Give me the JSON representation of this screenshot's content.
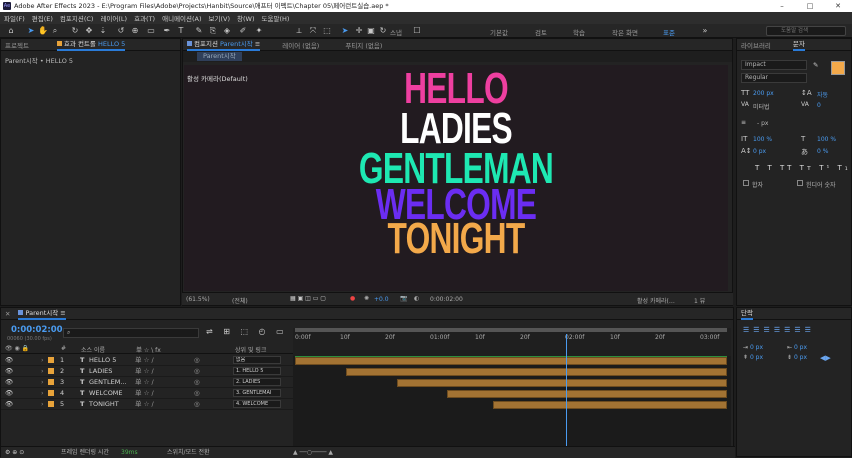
{
  "window": {
    "title": "Adobe After Effects 2023 - E:\\Program Files\\Adobe\\Projects\\Hanbit\\Source\\애프터 이펙트\\Chapter 05\\페어런트실습.aep *",
    "minimize": "–",
    "maximize": "□",
    "close": "✕"
  },
  "menu": [
    "파일(F)",
    "편집(E)",
    "컴포지션(C)",
    "레이어(L)",
    "효과(T)",
    "애니메이션(A)",
    "보기(V)",
    "창(W)",
    "도움말(H)"
  ],
  "toolbar": {
    "snap_label": "스냅",
    "workspaces": [
      "기본값",
      "검토",
      "학습",
      "작은 화면",
      "표준"
    ],
    "search_placeholder": "도움말 검색"
  },
  "project_panel": {
    "tab_project": "프로젝트",
    "tab_effects": "효과 컨트롤",
    "tab_effects_target": "HELLO 5",
    "breadcrumb": "Parent시작 • HELLO 5"
  },
  "comp_panel": {
    "tab_comp": "컴포지션",
    "comp_name": "Parent시작",
    "tab_layer": "레이어 (없음)",
    "tab_footage": "푸티지 (없음)",
    "flow_tab": "Parent시작",
    "camera_label": "활성 카메라(Default)",
    "words": [
      {
        "text": "HELLO",
        "color": "#ee3fa0"
      },
      {
        "text": "LADIES",
        "color": "#ffffff"
      },
      {
        "text": "GENTLEMAN",
        "color": "#1ee8b2"
      },
      {
        "text": "WELCOME",
        "color": "#6b2df2"
      },
      {
        "text": "TONIGHT",
        "color": "#f3a94a"
      }
    ],
    "footer": {
      "zoom": "(61.5%)",
      "quality": "(전체)",
      "exposure": "+0.0",
      "time": "0:00:02:00",
      "view": "활성 카메라(…",
      "views": "1 뷰"
    }
  },
  "right_panel": {
    "tab_library": "라이브러리",
    "tab_character": "문자",
    "font": "Impact",
    "style": "Regular",
    "size": "200 px",
    "leading": "자동",
    "kerning": "미터법",
    "tracking": "0",
    "stroke": "- px",
    "vscale": "100 %",
    "hscale": "100 %",
    "baseline": "0 px",
    "tsume": "0 %",
    "fill_color": "#f3a94a",
    "faux_bold": "합자",
    "hindi_digits": "힌디어 숫자",
    "paragraph_tab": "단락",
    "indent_values": [
      "0 px",
      "0 px",
      "0 px",
      "0 px",
      "0 px"
    ]
  },
  "timeline": {
    "tab": "Parent시작",
    "timecode": "0:00:02:00",
    "timecode_sub": "00060 (30.00 fps)",
    "search_placeholder": "",
    "columns": {
      "num": "#",
      "source": "소스 이름",
      "switches": "单 ☆ \\ fx",
      "parent": "상위 및 링크"
    },
    "ruler": [
      "0:00f",
      "10f",
      "20f",
      "01:00f",
      "10f",
      "20f",
      "02:00f",
      "10f",
      "20f",
      "03:00f"
    ],
    "layers": [
      {
        "num": "1",
        "name": "HELLO 5",
        "parent": "없음"
      },
      {
        "num": "2",
        "name": "LADIES",
        "parent": "1. HELLO 5"
      },
      {
        "num": "3",
        "name": "GENTLEM...",
        "parent": "2. LADIES"
      },
      {
        "num": "4",
        "name": "WELCOME",
        "parent": "3. GENTLEMAI"
      },
      {
        "num": "5",
        "name": "TONIGHT",
        "parent": "4. WELCOME"
      }
    ],
    "bar_starts": [
      0,
      0.118,
      0.235,
      0.353,
      0.459
    ],
    "playhead": 0.627,
    "status": "프레임 렌더링 시간",
    "render_time": "39ms",
    "toggle": "스위치/모드 전환"
  }
}
